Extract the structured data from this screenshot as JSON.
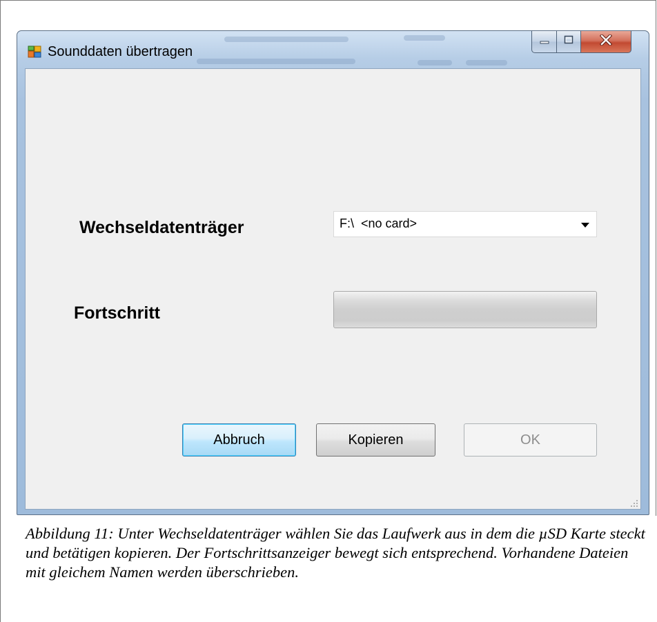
{
  "window": {
    "title": "Sounddaten übertragen",
    "icon": "app-window-icon",
    "controls": {
      "minimize_icon": "minimize-icon",
      "maximize_icon": "maximize-icon",
      "close_icon": "close-icon"
    }
  },
  "form": {
    "drive_label": "Wechseldatenträger",
    "drive_value": "F:\\  <no card>",
    "progress_label": "Fortschritt",
    "progress_value": 0
  },
  "buttons": {
    "cancel_label": "Abbruch",
    "copy_label": "Kopieren",
    "ok_label": "OK"
  },
  "caption": {
    "text": "Abbildung 11: Unter Wechseldatenträger wählen Sie das Laufwerk aus in dem die µSD Karte steckt und betätigen kopieren. Der Fortschrittsanzeiger bewegt sich entsprechend. Vorhandene Dateien mit gleichem Namen werden überschrieben."
  },
  "colors": {
    "close_button": "#c94a32",
    "titlebar": "#b6cde6",
    "client_background": "#f0f0f0",
    "default_button_border": "#3c7fb1"
  }
}
